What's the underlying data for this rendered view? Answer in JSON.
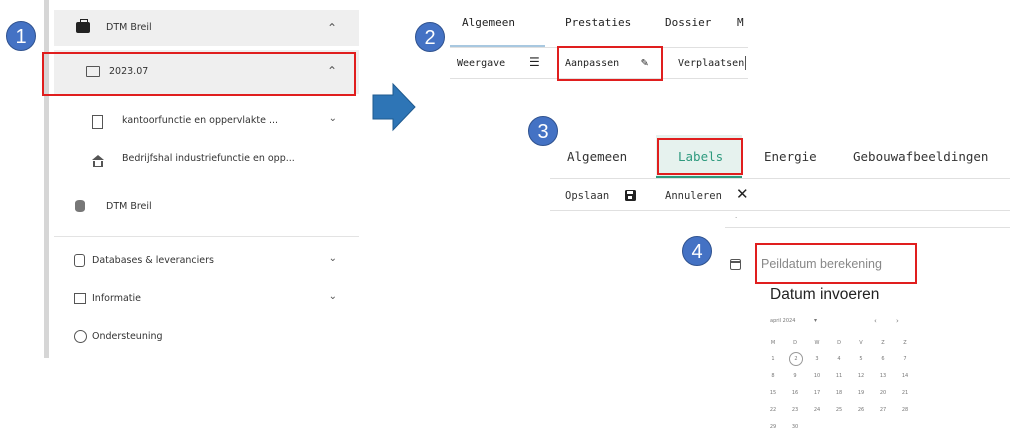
{
  "badges": [
    "1",
    "2",
    "3",
    "4"
  ],
  "panel1": {
    "project": "DTM Breil",
    "folder": "2023.07",
    "items": [
      "kantoorfunctie en oppervlakte ...",
      "Bedrijfshal industriefunctie en opp..."
    ],
    "database": "DTM Breil",
    "menu": [
      "Databases & leveranciers",
      "Informatie",
      "Ondersteuning"
    ]
  },
  "panel2": {
    "tabs": [
      "Algemeen",
      "Prestaties",
      "Dossier",
      "M"
    ],
    "toolbar": [
      "Weergave",
      "Aanpassen",
      "Verplaatsen"
    ]
  },
  "panel3": {
    "tabs": [
      "Algemeen",
      "Labels",
      "Energie",
      "Gebouwafbeeldingen"
    ],
    "toolbar": [
      "Opslaan",
      "Annuleren"
    ],
    "dot": "."
  },
  "panel4": {
    "placeholder": "Peildatum berekening",
    "title": "Datum invoeren",
    "month": "april 2024",
    "weekdays": [
      "M",
      "D",
      "W",
      "D",
      "V",
      "Z",
      "Z"
    ],
    "weeks": [
      [
        "1",
        "2",
        "3",
        "4",
        "5",
        "6",
        "7"
      ],
      [
        "8",
        "9",
        "10",
        "11",
        "12",
        "13",
        "14"
      ],
      [
        "15",
        "16",
        "17",
        "18",
        "19",
        "20",
        "21"
      ],
      [
        "22",
        "23",
        "24",
        "25",
        "26",
        "27",
        "28"
      ],
      [
        "29",
        "30",
        "",
        "",
        "",
        "",
        ""
      ]
    ],
    "selected": "2"
  },
  "colors": {
    "badge": "#4472c4",
    "highlight": "#e01e1e",
    "arrow": "#2e75b6",
    "labels_tab_bg": "#e6f2ee",
    "labels_tab_text": "#2e9a7e"
  }
}
